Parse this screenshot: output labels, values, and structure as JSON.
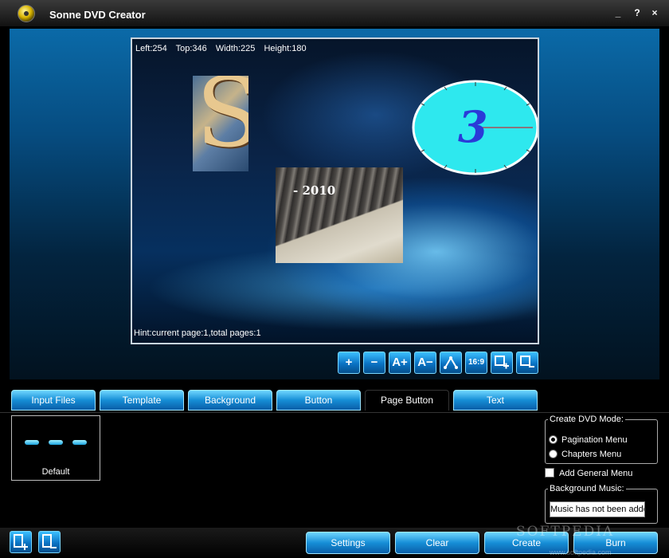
{
  "window": {
    "title": "Sonne DVD Creator",
    "minimize": "_",
    "help": "?",
    "close": "×"
  },
  "canvas": {
    "coords": {
      "left": "Left:254",
      "top": "Top:346",
      "width": "Width:225",
      "height": "Height:180"
    },
    "hint": "Hint:current page:1,total pages:1",
    "image_s_text": "S",
    "photo_label": "- 2010",
    "clock_text": "3"
  },
  "toolbar": {
    "add": "+",
    "remove": "−",
    "font_up": "A+",
    "font_down": "A−",
    "aspect_ratio": "16:9"
  },
  "tabs": [
    {
      "label": "Input Files"
    },
    {
      "label": "Template"
    },
    {
      "label": "Background"
    },
    {
      "label": "Button"
    },
    {
      "label": "Page Button"
    },
    {
      "label": "Text"
    }
  ],
  "active_tab": "Page Button",
  "panel": {
    "template_label": "Default",
    "mode_legend": "Create DVD Mode:",
    "pagination_label": "Pagination Menu",
    "chapters_label": "Chapters Menu",
    "selected_mode": "Pagination Menu",
    "general_menu_label": "Add General Menu",
    "general_menu_checked": false,
    "music_legend": "Background Music:",
    "music_value": "Music has not been added"
  },
  "bottom": {
    "settings": "Settings",
    "clear": "Clear",
    "create": "Create",
    "burn": "Burn"
  },
  "watermark": {
    "main": "SOFTPEDIA",
    "sub": "www.softpedia.com"
  }
}
